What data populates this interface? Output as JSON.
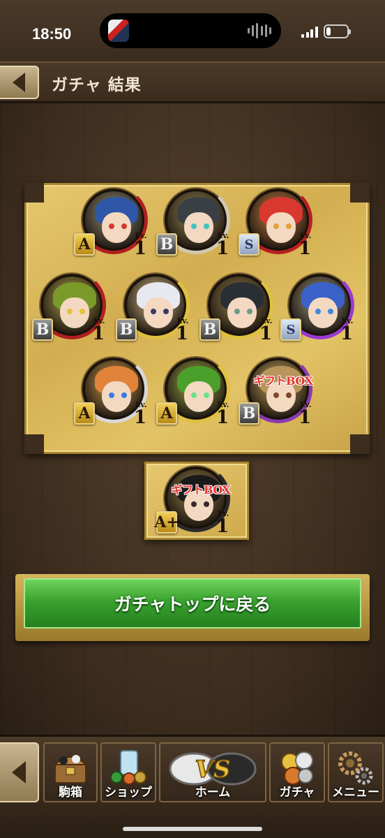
{
  "status_bar": {
    "time": "18:50",
    "battery_level": 0.2
  },
  "header": {
    "title": "ガチャ 結果"
  },
  "results": [
    {
      "rank": "A",
      "level_label": "Lv.",
      "level": "1",
      "gift_label": "",
      "hair": "#2f57a8",
      "eye": "#d23a2e",
      "ring": "#b02020"
    },
    {
      "rank": "B",
      "level_label": "Lv.",
      "level": "1",
      "gift_label": "",
      "hair": "#3a3f45",
      "eye": "#41c3c0",
      "ring": "#d0c8b0"
    },
    {
      "rank": "S",
      "level_label": "Lv.",
      "level": "1",
      "gift_label": "",
      "hair": "#d8382e",
      "eye": "#e2a23a",
      "ring": "#b82020"
    },
    {
      "rank": "B",
      "level_label": "Lv.",
      "level": "1",
      "gift_label": "",
      "hair": "#7a9a2a",
      "eye": "#e2c23a",
      "ring": "#b02020"
    },
    {
      "rank": "B",
      "level_label": "Lv.",
      "level": "1",
      "gift_label": "",
      "hair": "#e8e8f0",
      "eye": "#3a3a66",
      "ring": "#e0c040"
    },
    {
      "rank": "B",
      "level_label": "Lv.",
      "level": "1",
      "gift_label": "",
      "hair": "#2a2f35",
      "eye": "#6a9a8a",
      "ring": "#e0c040"
    },
    {
      "rank": "S",
      "level_label": "Lv.",
      "level": "1",
      "gift_label": "",
      "hair": "#3a62c8",
      "eye": "#3a8ad8",
      "ring": "#9a3ad0"
    },
    {
      "rank": "A",
      "level_label": "Lv.",
      "level": "1",
      "gift_label": "",
      "hair": "#e2833a",
      "eye": "#3a7ae2",
      "ring": "#d8d8d8"
    },
    {
      "rank": "A",
      "level_label": "Lv.",
      "level": "1",
      "gift_label": "",
      "hair": "#4aa02a",
      "eye": "#6ae28a",
      "ring": "#e0c040"
    },
    {
      "rank": "B",
      "level_label": "Lv.",
      "level": "1",
      "gift_label": "ギフトBOX",
      "hair": "#b8955a",
      "eye": "#7a4a2a",
      "ring": "#8a3ab0"
    }
  ],
  "extra_result": {
    "rank": "A+",
    "level_label": "Lv.",
    "level": "1",
    "gift_label": "ギフトBOX",
    "hair": "#1a1a1a",
    "eye": "#3a2a2a",
    "ring": "#2a2a2a"
  },
  "return_button": {
    "label": "ガチャトップに戻る"
  },
  "bottom_nav": {
    "items": [
      {
        "label": "駒箱",
        "icon": "treasure-chest-icon"
      },
      {
        "label": "ショップ",
        "icon": "shop-items-icon"
      },
      {
        "label": "ホーム",
        "icon": "versus-coin-icon"
      },
      {
        "label": "ガチャ",
        "icon": "gacha-coins-icon"
      },
      {
        "label": "メニュー",
        "icon": "gears-icon"
      }
    ]
  },
  "colors": {
    "board_gold": "#d3ae50",
    "return_green": "#3aa22f",
    "gift_red": "#e8312a"
  }
}
